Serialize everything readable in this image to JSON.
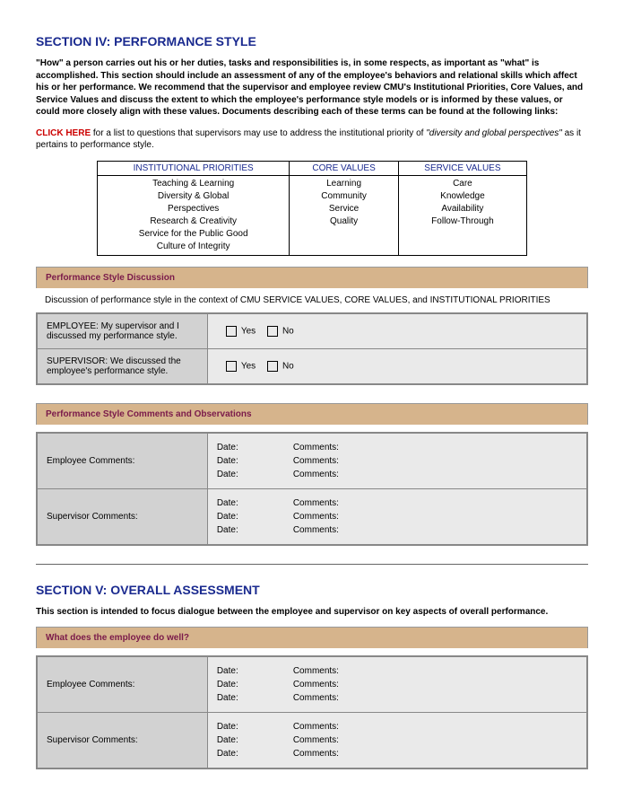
{
  "section4": {
    "title": "SECTION IV: PERFORMANCE STYLE",
    "paragraph": "\"How\" a person carries out his or her duties, tasks and responsibilities is, in some respects, as important as \"what\" is accomplished. This section should include an assessment of any of the employee's behaviors and relational skills which affect his or her performance. We recommend that the supervisor and employee review CMU's Institutional Priorities, Core Values, and Service Values and discuss the extent to which the employee's performance style models or is informed by these values, or could more closely align with these values. Documents describing each of these terms can be found at the following links:",
    "clickHere": "CLICK HERE",
    "clickText1": " for a list to questions that supervisors may use to address the institutional priority of ",
    "clickItalic": "\"diversity and global perspectives\"",
    "clickText2": " as it pertains to performance style.",
    "tableHeaders": {
      "col1": "INSTITUTIONAL PRIORITIES",
      "col2": "CORE VALUES",
      "col3": "SERVICE VALUES"
    },
    "tableCol1": "Teaching & Learning\nDiversity & Global\nPerspectives\nResearch & Creativity\nService for the Public Good\nCulture of Integrity",
    "tableCol2": "Learning\nCommunity\nService\nQuality",
    "tableCol3": "Care\nKnowledge\nAvailability\nFollow-Through",
    "band1": "Performance Style Discussion",
    "discussionText": "Discussion of performance style in the context of CMU SERVICE VALUES, CORE VALUES, and INSTITUTIONAL PRIORITIES",
    "row1": "EMPLOYEE: My supervisor and I discussed my performance style.",
    "row2": "SUPERVISOR: We discussed the employee's performance style.",
    "yes": "Yes",
    "no": "No",
    "band2": "Performance Style Comments and Observations",
    "empComments": "Employee Comments:",
    "supComments": "Supervisor Comments:",
    "dateLabel": "Date:",
    "commentsLabel": "Comments:"
  },
  "section5": {
    "title": "SECTION V: OVERALL ASSESSMENT",
    "paragraph": "This section is intended to focus dialogue between the employee and supervisor on key aspects of overall performance.",
    "band1": "What does the employee do well?",
    "empComments": "Employee Comments:",
    "supComments": "Supervisor Comments:",
    "dateLabel": "Date:",
    "commentsLabel": "Comments:"
  }
}
